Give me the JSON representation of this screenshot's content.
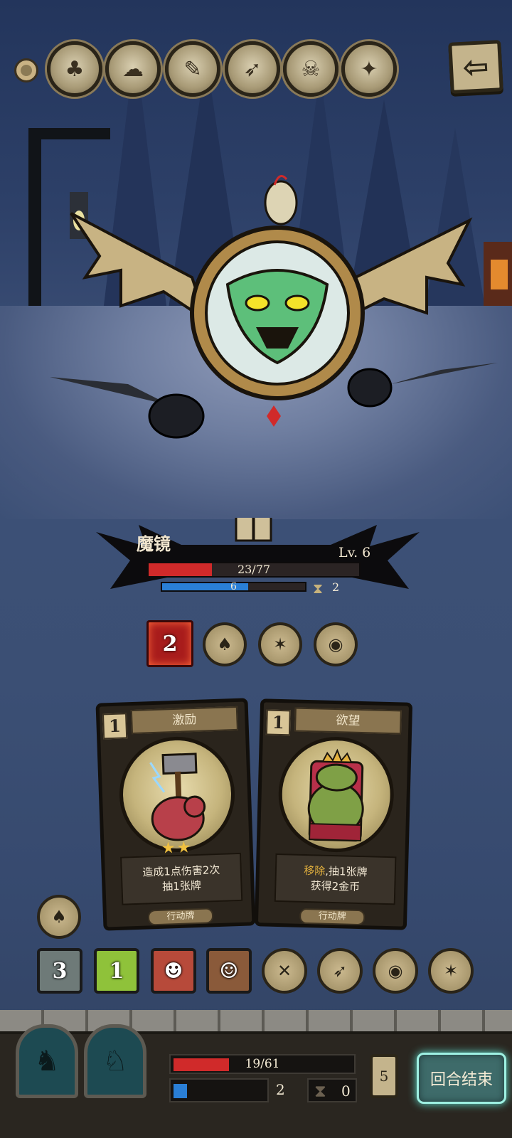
{
  "relics": [
    {
      "icon": "tree-stump-relic-icon",
      "glyph": "♣"
    },
    {
      "icon": "ghost-relic-icon",
      "glyph": "☁"
    },
    {
      "icon": "scroll-relic-icon",
      "glyph": "✎"
    },
    {
      "icon": "feather-relic-icon",
      "glyph": "➶"
    },
    {
      "icon": "demon-relic-icon",
      "glyph": "☠"
    },
    {
      "icon": "dagger-relic-icon",
      "glyph": "✦"
    }
  ],
  "back_glyph": "⇦",
  "enemy": {
    "name": "魔镜",
    "level": "Lv. 6",
    "hp_text": "23/77",
    "hp_fraction": 0.3,
    "mp_text": "6",
    "mp_fraction": 0.6,
    "hourglass": "2",
    "intent_value": "2"
  },
  "enemy_status": [
    {
      "icon": "hood-status-icon",
      "glyph": "♠"
    },
    {
      "icon": "bat-status-icon",
      "glyph": "✶"
    },
    {
      "icon": "coin-status-icon",
      "glyph": "◉"
    }
  ],
  "cards": [
    {
      "cost": "1",
      "title": "激励",
      "stars": "★★",
      "desc_line1": "造成1点伤害2次",
      "desc_line2": "抽1张牌",
      "type": "行动牌",
      "art_glyph": "⚒"
    },
    {
      "cost": "1",
      "title": "欲望",
      "desc_highlight": "移除",
      "desc_line1_rest": ",抽1张牌",
      "desc_line2": "获得2金币",
      "type": "行动牌",
      "art_glyph": "♛"
    }
  ],
  "left_button": {
    "icon": "hood-button-icon",
    "glyph": "♠"
  },
  "items": [
    {
      "kind": "square",
      "icon": "stone-item-icon",
      "count": "3",
      "bg": "#6e7a78"
    },
    {
      "kind": "square",
      "icon": "leaf-item-icon",
      "count": "1",
      "bg": "#8fc23a"
    },
    {
      "kind": "square",
      "icon": "mask-item-icon",
      "glyph": "☻",
      "bg": "#b74a3a"
    },
    {
      "kind": "square",
      "icon": "bandit-item-icon",
      "glyph": "☺",
      "bg": "#8a5a3a"
    },
    {
      "kind": "round",
      "icon": "crossbow-item-icon",
      "glyph": "✕"
    },
    {
      "kind": "round",
      "icon": "arrows-item-icon",
      "glyph": "➶"
    },
    {
      "kind": "round",
      "icon": "coin-item-icon",
      "glyph": "◉"
    },
    {
      "kind": "round",
      "icon": "bat-item-icon",
      "glyph": "✶"
    }
  ],
  "player": {
    "hp_text": "19/61",
    "hp_fraction": 0.31,
    "mp_value": "2",
    "mp_fraction": 0.15,
    "hourglass": "0",
    "deck_count": "5"
  },
  "end_turn_label": "回合结束",
  "colors": {
    "hp": "#d02a2a",
    "mp": "#2a7fd6",
    "end_turn_glow": "#9ef0e2",
    "highlight_text": "#e4b23e"
  }
}
